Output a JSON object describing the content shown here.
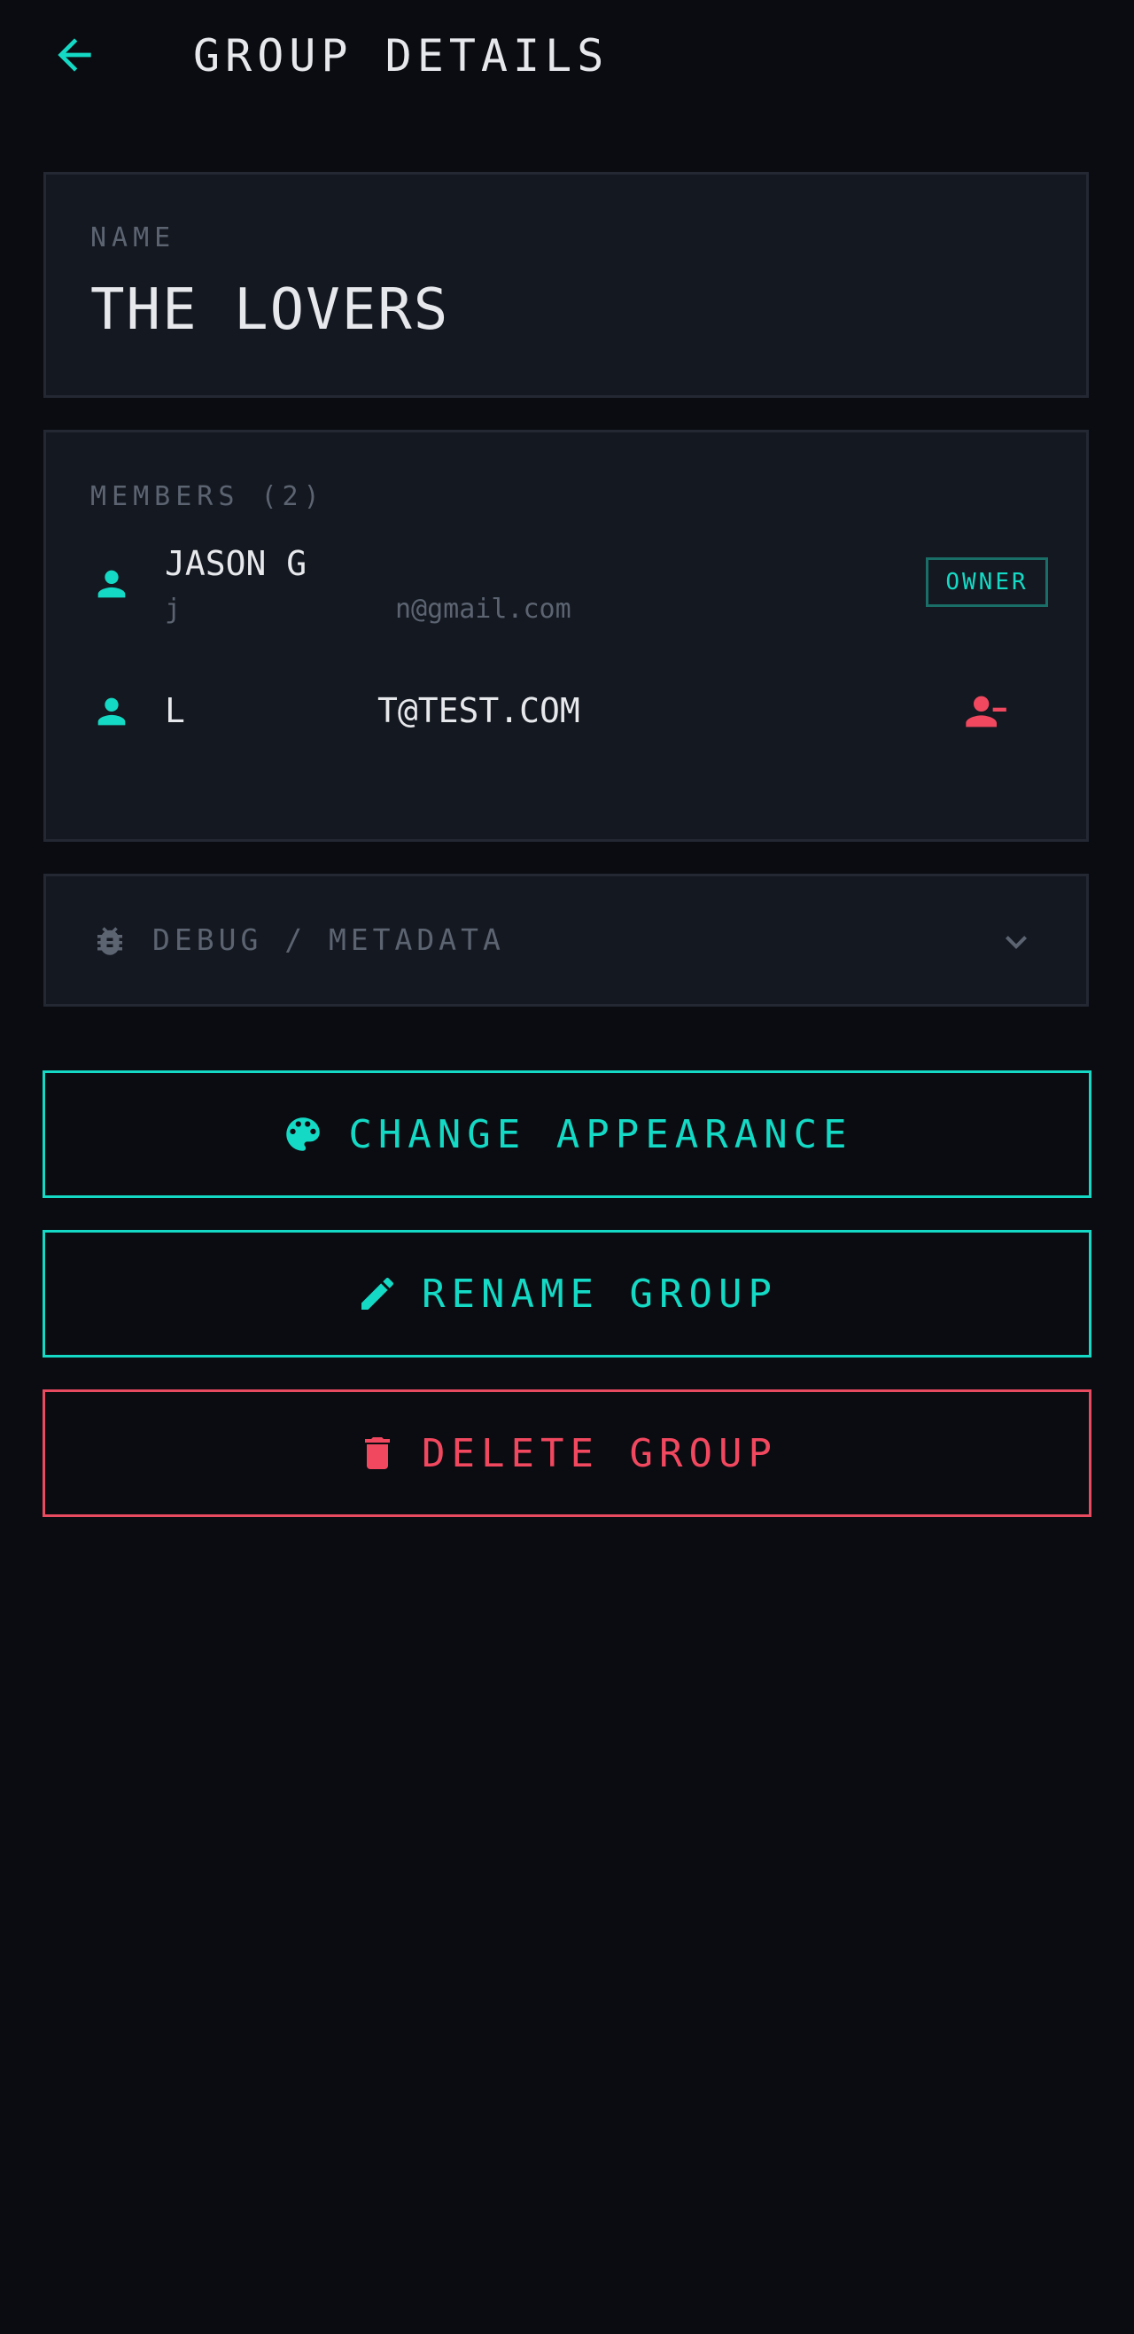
{
  "header": {
    "title": "GROUP DETAILS",
    "back_icon": "arrow-left-icon"
  },
  "name_section": {
    "label": "NAME",
    "value": "THE LOVERS"
  },
  "members_section": {
    "label": "MEMBERS (2)",
    "members": [
      {
        "name_prefix": "JASON G",
        "name_suffix": "",
        "email_prefix": "j",
        "email_suffix": "n@gmail.com",
        "badge": "OWNER",
        "icon": "person-icon"
      },
      {
        "name_prefix": "L",
        "name_suffix": "T@TEST.COM",
        "icon": "person-icon",
        "action_icon": "person-remove-icon"
      }
    ]
  },
  "debug_section": {
    "label": "DEBUG / METADATA",
    "icon": "bug-icon",
    "toggle_icon": "chevron-down-icon"
  },
  "actions": {
    "change_appearance": "CHANGE APPEARANCE",
    "rename_group": "RENAME GROUP",
    "delete_group": "DELETE GROUP"
  },
  "colors": {
    "background": "#0a0c12",
    "card": "#141820",
    "accent": "#14d9c4",
    "danger": "#f2485f",
    "muted": "#5c6472"
  }
}
